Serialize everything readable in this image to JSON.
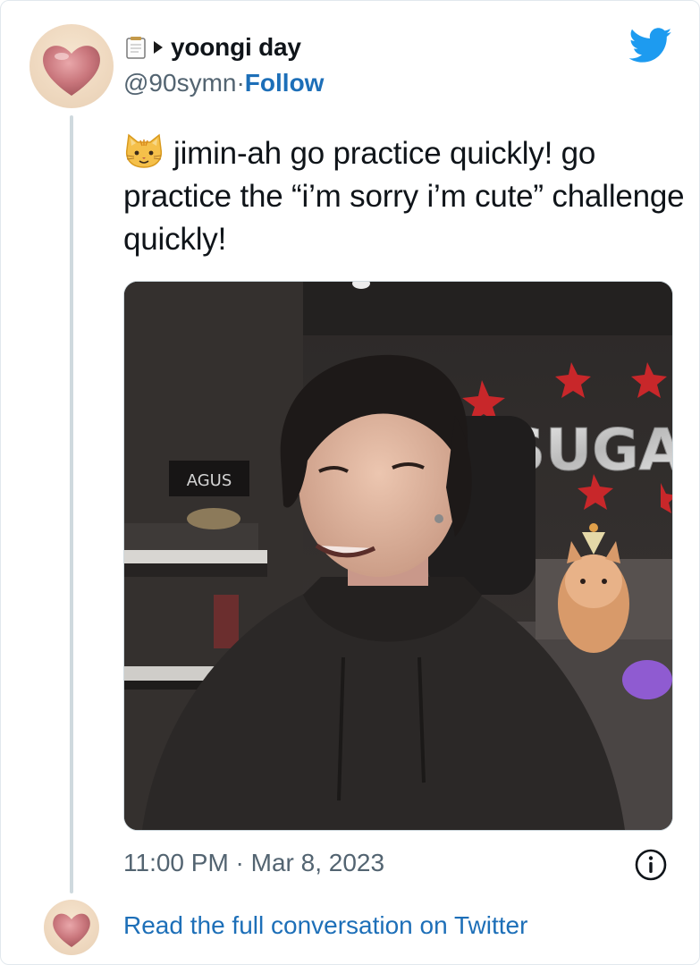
{
  "user": {
    "display_name": "yoongi day",
    "handle": "@90symn",
    "separator": " · ",
    "follow_label": "Follow"
  },
  "tweet": {
    "text": "jimin-ah go practice quickly! go practice the “i’m sorry i’m cute” challenge quickly!",
    "cat_emoji": "cat-face-emoji",
    "timestamp": "11:00 PM · Mar 8, 2023"
  },
  "media": {
    "balloon_letters": "SUGA",
    "label_sign": "AGUS"
  },
  "footer": {
    "read_full_label": "Read the full conversation on Twitter"
  },
  "colors": {
    "twitter_blue": "#1d9bf0",
    "link_blue": "#1d6fb8",
    "secondary_text": "#536471",
    "thread_line": "#cfd9de"
  },
  "icons": [
    "heart-avatar-icon",
    "memo-icon",
    "arrow-icon",
    "twitter-bird-icon",
    "info-icon"
  ]
}
